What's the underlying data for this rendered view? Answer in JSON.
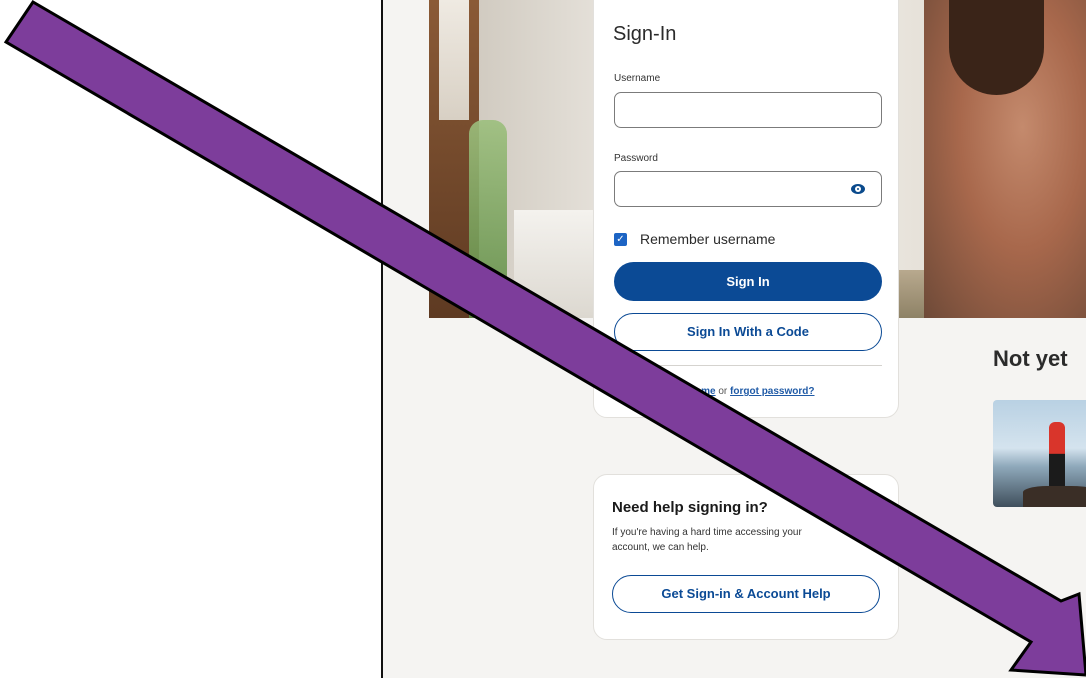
{
  "signin": {
    "title": "Sign-In",
    "username_label": "Username",
    "username_value": "",
    "password_label": "Password",
    "password_value": "",
    "remember_label": "Remember username",
    "remember_checked": true,
    "signin_button": "Sign In",
    "code_button": "Sign In With a Code",
    "forgot_username_fragment": "ername",
    "or_text": "or",
    "forgot_password": "forgot password?"
  },
  "help": {
    "title": "Need help signing in?",
    "text_line1": "If you're having a hard time accessing your",
    "text_line2": "account, we can help.",
    "button": "Get Sign-in & Account Help"
  },
  "promo": {
    "heading_fragment": "Not yet"
  },
  "annotation": {
    "arrow_color": "#7d3d9b",
    "arrow_outline": "#000000"
  },
  "colors": {
    "primary": "#0b4a95",
    "page_bg": "#f5f4f2",
    "checkbox": "#1c64c4"
  },
  "icons": [
    "eye-icon",
    "checkmark-icon"
  ]
}
